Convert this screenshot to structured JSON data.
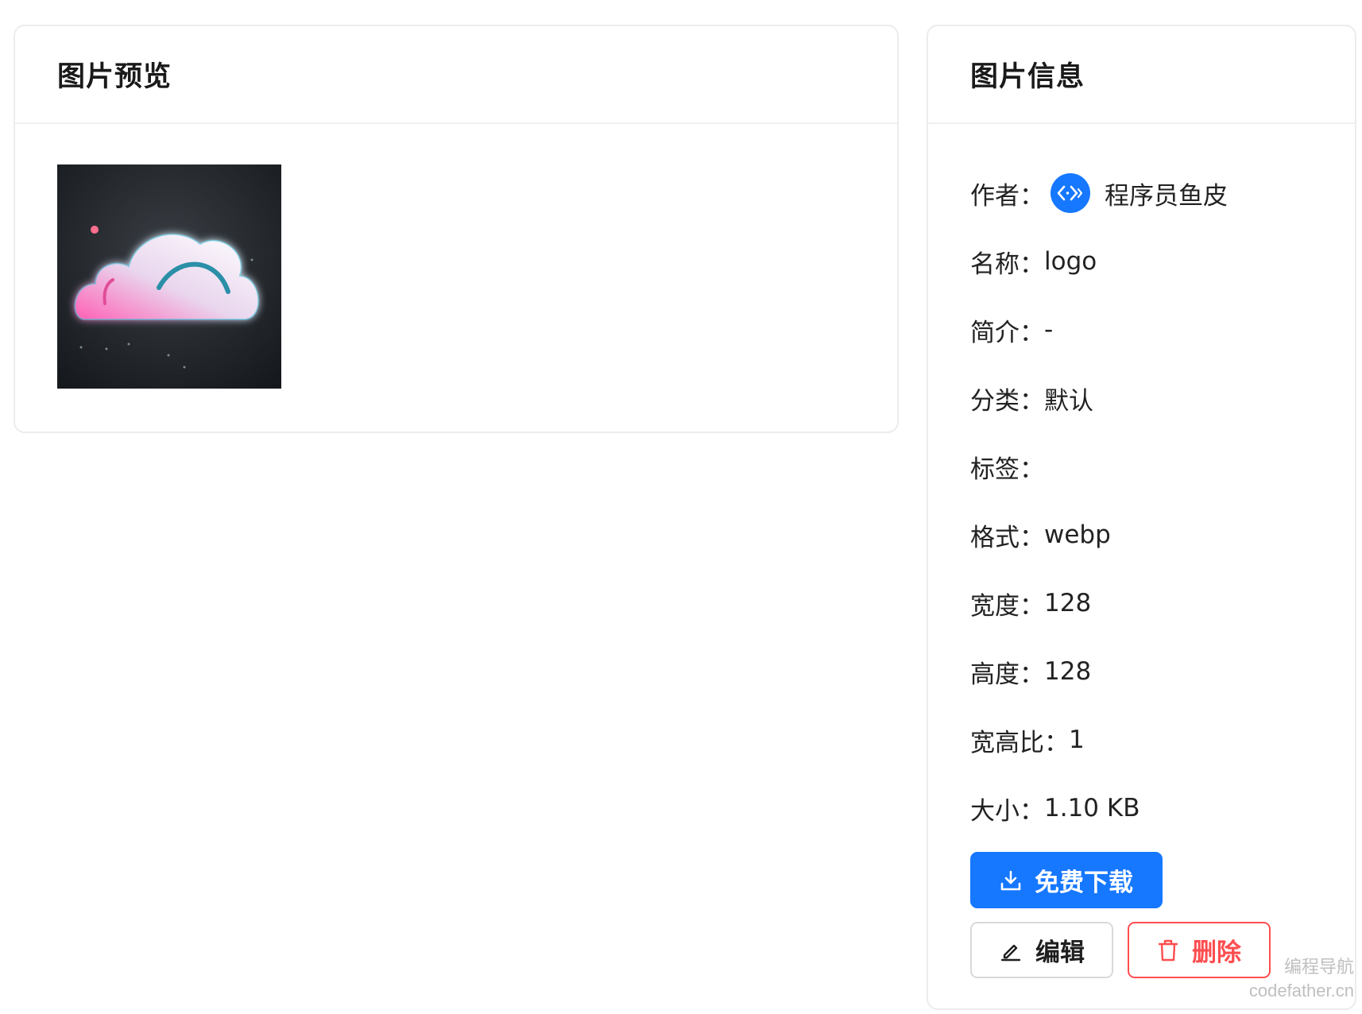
{
  "preview": {
    "title": "图片预览"
  },
  "info": {
    "title": "图片信息",
    "author_label": "作者：",
    "author_name": "程序员鱼皮",
    "fields": [
      {
        "label": "名称：",
        "value": "logo"
      },
      {
        "label": "简介：",
        "value": "-"
      },
      {
        "label": "分类：",
        "value": "默认"
      },
      {
        "label": "标签：",
        "value": ""
      },
      {
        "label": "格式：",
        "value": "webp"
      },
      {
        "label": "宽度：",
        "value": "128"
      },
      {
        "label": "高度：",
        "value": "128"
      },
      {
        "label": "宽高比：",
        "value": "1"
      },
      {
        "label": "大小：",
        "value": "1.10 KB"
      }
    ]
  },
  "actions": {
    "download_label": "免费下载",
    "edit_label": "编辑",
    "delete_label": "删除"
  },
  "colors": {
    "primary": "#1677ff",
    "danger": "#ff4d4f"
  },
  "icons": {
    "download": "download-icon",
    "edit": "edit-icon",
    "delete": "delete-icon",
    "avatar": "code-avatar-icon"
  },
  "watermark": {
    "line1": "编程导航",
    "line2": "codefather.cn"
  }
}
